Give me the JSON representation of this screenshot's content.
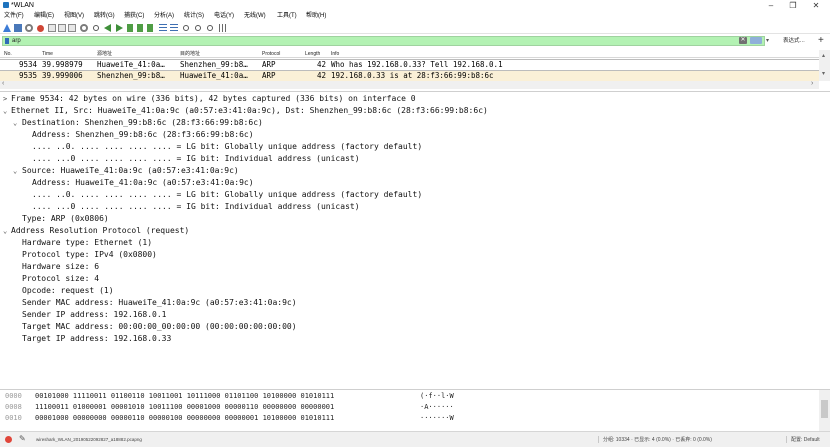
{
  "window": {
    "title": "*WLAN"
  },
  "menu": [
    "文件(F)",
    "编辑(E)",
    "视图(V)",
    "跳转(G)",
    "捕获(C)",
    "分析(A)",
    "统计(S)",
    "电话(Y)",
    "无线(W)",
    "工具(T)",
    "帮助(H)"
  ],
  "filter": {
    "value": "arp",
    "expression_label": "表达式…",
    "add_label": "+"
  },
  "packet_list": {
    "columns": [
      "No.",
      "Time",
      "源地址",
      "目的地址",
      "Protocol",
      "Length",
      "Info"
    ],
    "rows": [
      {
        "no": "9534",
        "time": "39.998979",
        "src": "HuaweiTe_41:0a…",
        "dst": "Shenzhen_99:b8…",
        "proto": "ARP",
        "len": "42",
        "info": "Who has 192.168.0.33? Tell 192.168.0.1"
      },
      {
        "no": "9535",
        "time": "39.999006",
        "src": "Shenzhen_99:b8…",
        "dst": "HuaweiTe_41:0a…",
        "proto": "ARP",
        "len": "42",
        "info": "192.168.0.33 is at 28:f3:66:99:b8:6c"
      }
    ]
  },
  "details": [
    {
      "arrow": ">",
      "text": "Frame 9534: 42 bytes on wire (336 bits), 42 bytes captured (336 bits) on interface 0"
    },
    {
      "arrow": "⌄",
      "text": "Ethernet II, Src: HuaweiTe_41:0a:9c (a0:57:e3:41:0a:9c), Dst: Shenzhen_99:b8:6c (28:f3:66:99:b8:6c)"
    },
    {
      "arrow": "⌄",
      "text": "Destination: Shenzhen_99:b8:6c (28:f3:66:99:b8:6c)"
    },
    {
      "arrow": "",
      "text": "Address: Shenzhen_99:b8:6c (28:f3:66:99:b8:6c)"
    },
    {
      "arrow": "",
      "text": ".... ..0. .... .... .... .... = LG bit: Globally unique address (factory default)"
    },
    {
      "arrow": "",
      "text": ".... ...0 .... .... .... .... = IG bit: Individual address (unicast)"
    },
    {
      "arrow": "⌄",
      "text": "Source: HuaweiTe_41:0a:9c (a0:57:e3:41:0a:9c)"
    },
    {
      "arrow": "",
      "text": "Address: HuaweiTe_41:0a:9c (a0:57:e3:41:0a:9c)"
    },
    {
      "arrow": "",
      "text": ".... ..0. .... .... .... .... = LG bit: Globally unique address (factory default)"
    },
    {
      "arrow": "",
      "text": ".... ...0 .... .... .... .... = IG bit: Individual address (unicast)"
    },
    {
      "arrow": "",
      "text": "Type: ARP (0x0806)"
    },
    {
      "arrow": "⌄",
      "text": "Address Resolution Protocol (request)"
    },
    {
      "arrow": "",
      "text": "Hardware type: Ethernet (1)"
    },
    {
      "arrow": "",
      "text": "Protocol type: IPv4 (0x0800)"
    },
    {
      "arrow": "",
      "text": "Hardware size: 6"
    },
    {
      "arrow": "",
      "text": "Protocol size: 4"
    },
    {
      "arrow": "",
      "text": "Opcode: request (1)"
    },
    {
      "arrow": "",
      "text": "Sender MAC address: HuaweiTe_41:0a:9c (a0:57:e3:41:0a:9c)"
    },
    {
      "arrow": "",
      "text": "Sender IP address: 192.168.0.1"
    },
    {
      "arrow": "",
      "text": "Target MAC address: 00:00:00_00:00:00 (00:00:00:00:00:00)"
    },
    {
      "arrow": "",
      "text": "Target IP address: 192.168.0.33"
    }
  ],
  "bytes": [
    {
      "offset": "0000",
      "bits": "00101000 11110011 01100110 10011001 10111000 01101100 10100000 01010111",
      "ascii": "(·f··l·W"
    },
    {
      "offset": "0008",
      "bits": "11100011 01000001 00001010 10011100 00001000 00000110 00000000 00000001",
      "ascii": "·A······"
    },
    {
      "offset": "0010",
      "bits": "00001000 00000000 00000110 00000100 00000000 00000001 10100000 01010111",
      "ascii": "·······W"
    }
  ],
  "status": {
    "file": "wireshark_WLAN_20190522092827_a18882.pcapng",
    "stats": "分组: 10334 · 已显示: 4 (0.0%) · 已丢弃: 0 (0.0%)",
    "profile": "配置: Default"
  },
  "icons": [
    "shark-fin-icon",
    "stop-icon",
    "restart-icon",
    "options-icon",
    "open-icon",
    "save-icon",
    "close-file-icon",
    "reload-icon",
    "find-icon",
    "back-icon",
    "forward-icon",
    "goto-icon",
    "first-icon",
    "last-icon",
    "autoscroll-icon",
    "colorize-icon",
    "zoom-in-icon",
    "zoom-out-icon",
    "zoom-reset-icon",
    "resize-columns-icon"
  ]
}
